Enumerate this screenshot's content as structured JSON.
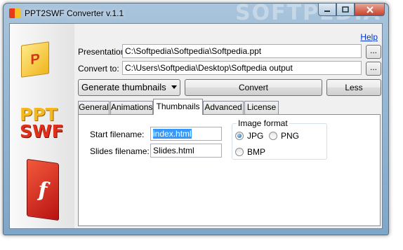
{
  "window": {
    "title": "PPT2SWF Converter v.1.1",
    "title_watermark": "SOFTPEDIA",
    "controls": {
      "minimize": "–",
      "maximize": "□",
      "close": "✕"
    }
  },
  "logos": {
    "p_letter": "P",
    "ppt_text": "PPT",
    "swf_text": "SWF",
    "flash_letter": "f"
  },
  "help_link": "Help",
  "presentation": {
    "label": "Presentation:",
    "value": "C:\\Softpedia\\Softpedia\\Softpedia.ppt",
    "browse": "..."
  },
  "convert_to": {
    "label": "Convert to:",
    "value": "C:\\Users\\Softpedia\\Desktop\\Softpedia output",
    "browse": "..."
  },
  "mode_select": {
    "value": "Generate thumbnails"
  },
  "buttons": {
    "convert": "Convert",
    "less": "Less"
  },
  "tabs": [
    {
      "label": "General"
    },
    {
      "label": "Animations"
    },
    {
      "label": "Thumbnails",
      "active": true
    },
    {
      "label": "Advanced"
    },
    {
      "label": "License"
    }
  ],
  "thumbnails": {
    "start_label": "Start filename:",
    "start_value": "index.html",
    "slides_label": "Slides filename:",
    "slides_value": "Slides.html",
    "image_format": {
      "title": "Image format",
      "options": [
        "JPG",
        "PNG",
        "BMP"
      ],
      "selected": "JPG"
    }
  },
  "colors": {
    "link": "#0033cc",
    "selection": "#3399ff",
    "close_button": "#c8412a"
  }
}
